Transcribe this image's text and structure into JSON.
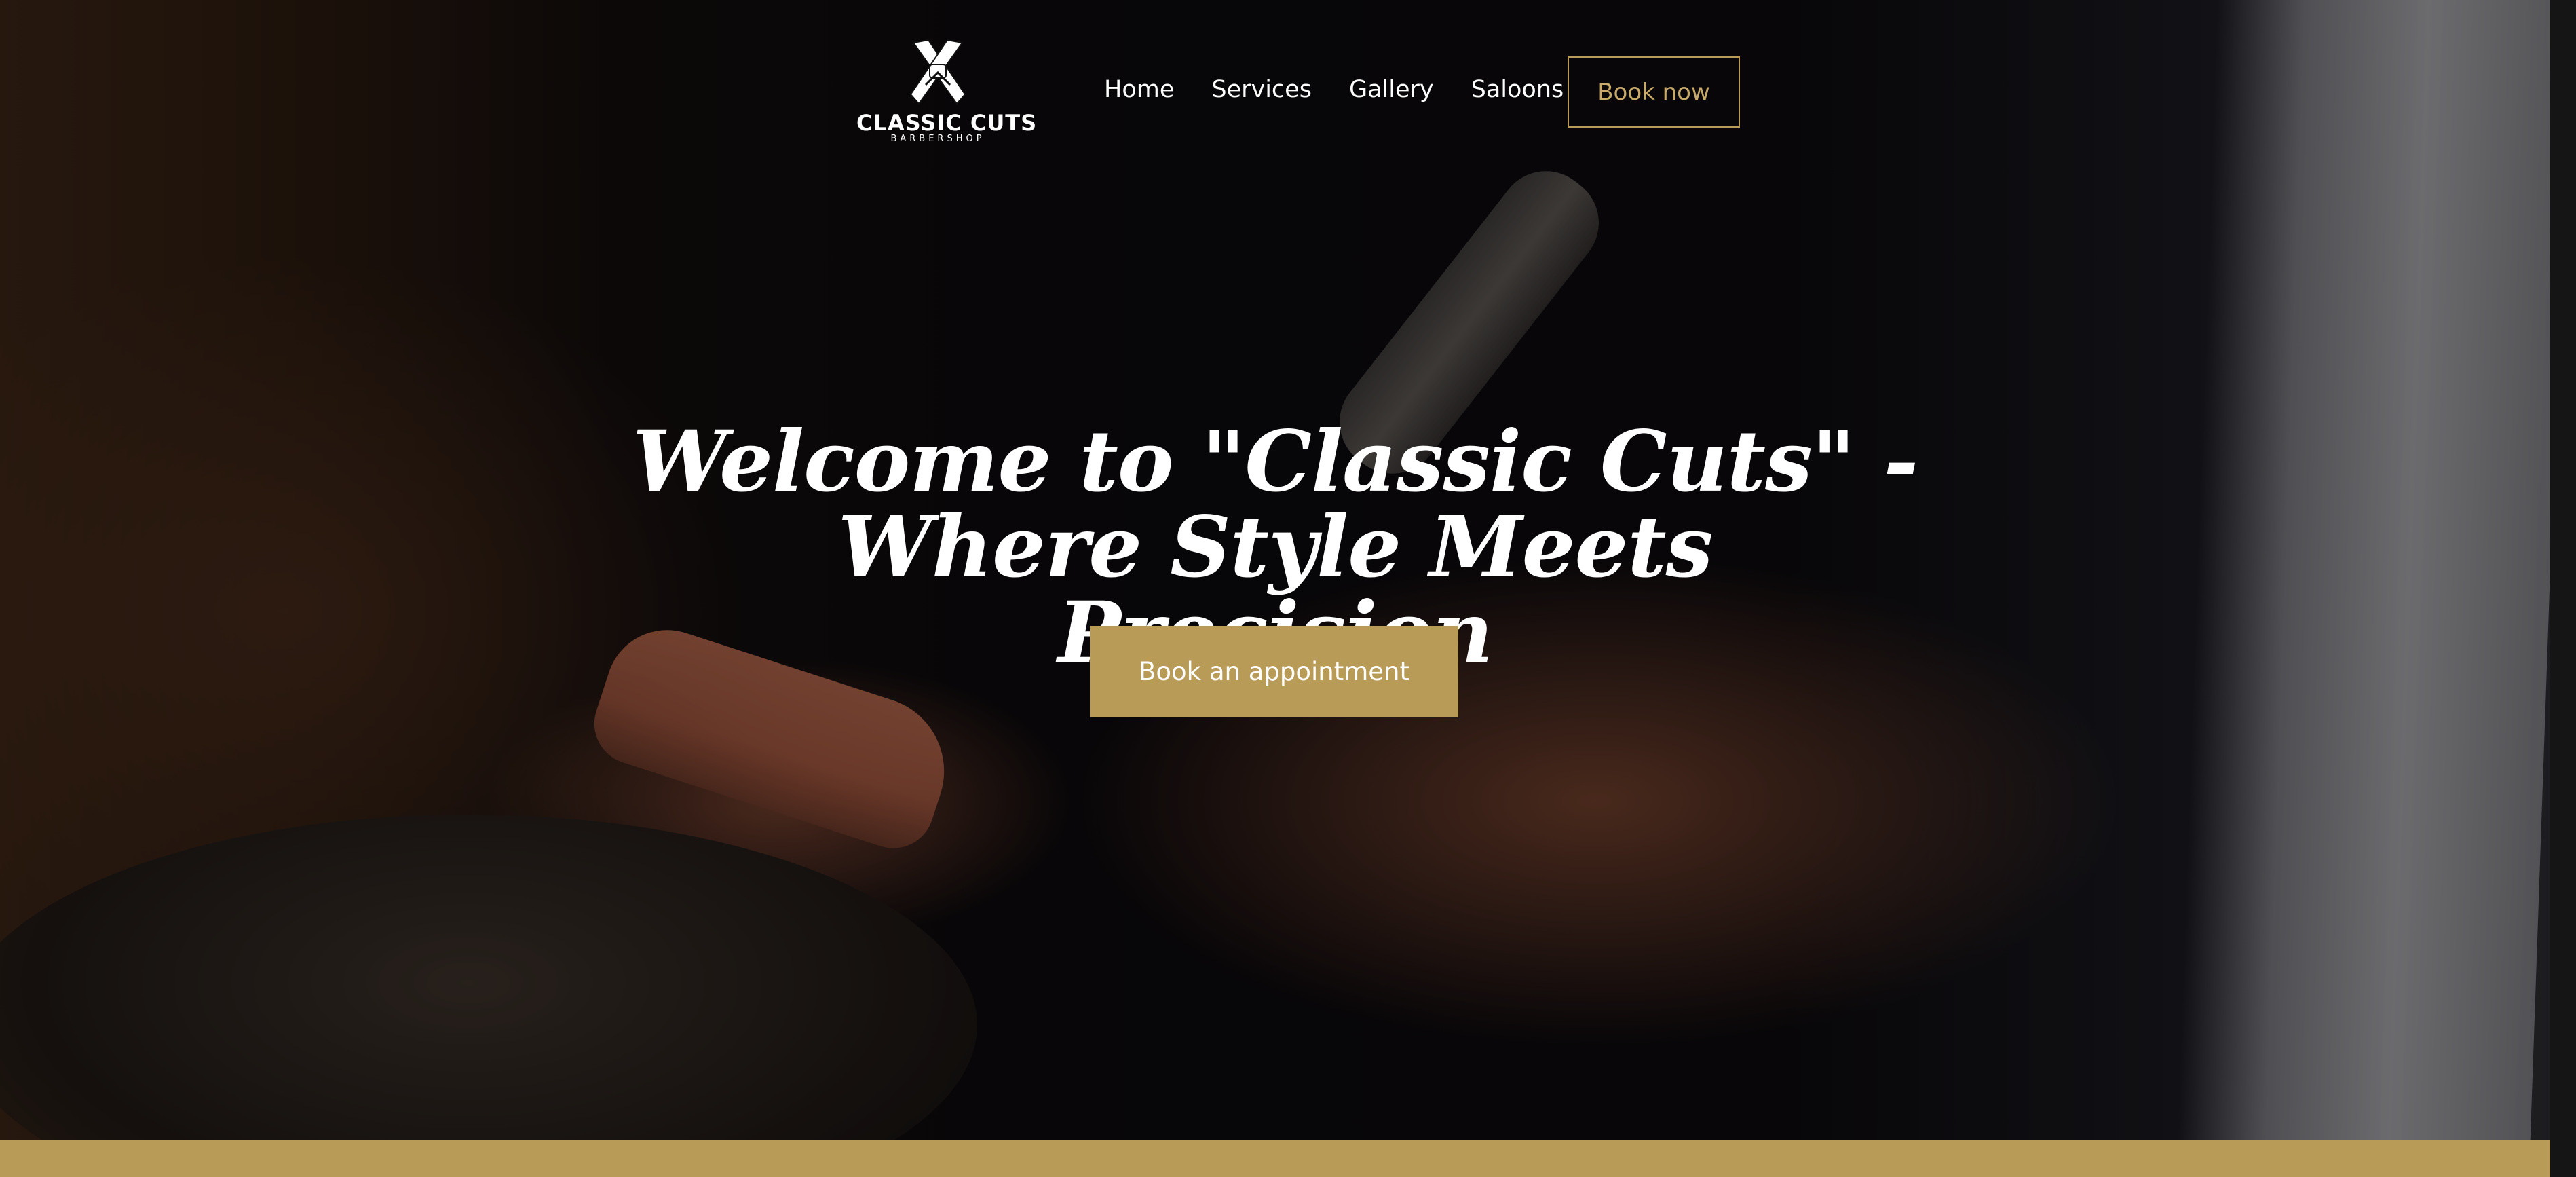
{
  "colors": {
    "accent": "#b89b57",
    "text": "#ffffff",
    "background": "#0b0a0c"
  },
  "header": {
    "logo": {
      "icon": "crossed-razors-icon",
      "name": "CLASSIC CUTS",
      "tagline": "BARBERSHOP"
    },
    "nav": {
      "items": [
        {
          "label": "Home"
        },
        {
          "label": "Services"
        },
        {
          "label": "Gallery"
        },
        {
          "label": "Saloons"
        }
      ],
      "book_label": "Book now"
    }
  },
  "hero": {
    "title_line1": "Welcome to \"Classic Cuts\" -",
    "title_line2": "Where Style Meets Precision",
    "cta_label": "Book an appointment"
  }
}
